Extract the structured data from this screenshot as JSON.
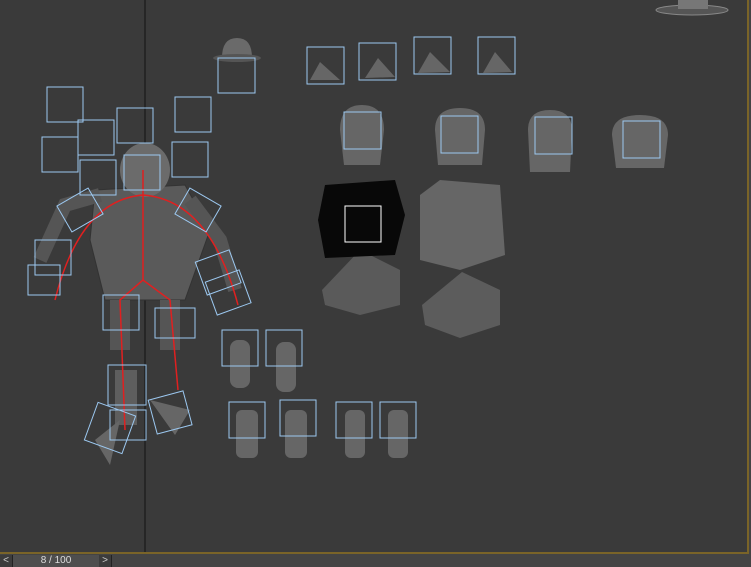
{
  "timeline": {
    "prev_label": "<",
    "next_label": ">",
    "frame_readout": "8 / 100",
    "current_frame": 8,
    "total_frames": 100
  },
  "colors": {
    "viewport_bg": "#3a3a3a",
    "active_border": "#7a6428",
    "bone_box": "#9cc8f0",
    "bone_line": "#e02020",
    "pivot": "#e8e020"
  }
}
